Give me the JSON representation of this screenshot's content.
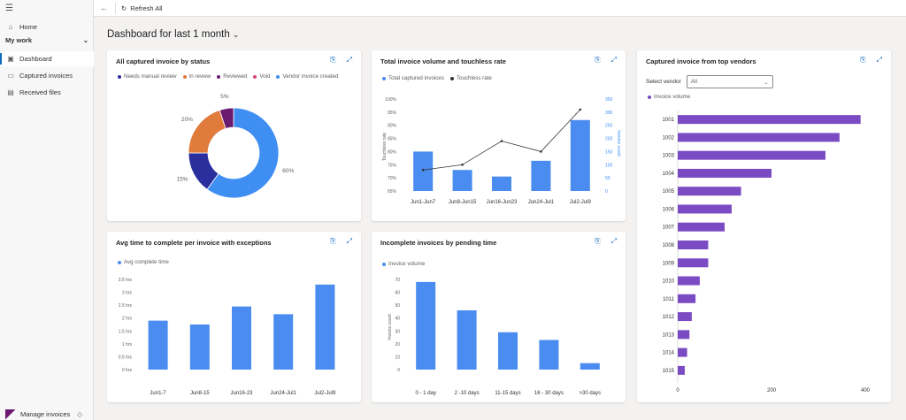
{
  "topbar": {
    "back_icon": "back-arrow-icon",
    "refresh_label": "Refresh All"
  },
  "sidebar": {
    "items": [
      {
        "label": "Home",
        "icon": "home-icon"
      },
      {
        "label": "Dashboard",
        "icon": "dashboard-icon",
        "active": true
      },
      {
        "label": "Captured invoices",
        "icon": "document-icon"
      },
      {
        "label": "Received files",
        "icon": "files-icon"
      }
    ],
    "section_label": "My work",
    "footer_label": "Manage invoices"
  },
  "page": {
    "title": "Dashboard for last 1 month"
  },
  "colors": {
    "accent": "#0f6cbd",
    "bar_blue": "#4a8cf0",
    "bar_purple": "#7b4bc4"
  },
  "cards": {
    "status": {
      "title": "All captured invoice by status",
      "chart_data": {
        "type": "pie",
        "labels": [
          "Needs manual review",
          "In review",
          "Reviewed",
          "Void",
          "Vendor invoice created"
        ],
        "values": [
          15,
          20,
          5,
          0,
          60
        ],
        "colors": [
          "#2b2f9e",
          "#e07b3c",
          "#6a1b6f",
          "#d6447f",
          "#3f8ef2"
        ],
        "slice_labels": [
          "15%",
          "20%",
          "5%",
          "",
          "60%"
        ]
      }
    },
    "volume": {
      "title": "Total invoice volume and touchless rate",
      "chart_data": {
        "type": "bar",
        "categories": [
          "Jun1-Jun7",
          "Jun8-Jun15",
          "Jun16-Jun23",
          "Jun24-Jul1",
          "Jul2-Jul9"
        ],
        "series": [
          {
            "name": "Total captured invoices",
            "values": [
              150,
              80,
              55,
              115,
              270
            ]
          },
          {
            "name": "Touchless rate",
            "values": [
              73,
              75,
              84,
              80,
              96
            ]
          }
        ],
        "ylabel": "Touchless rate",
        "y2label": "Invoice count",
        "yticks": [
          "65%",
          "70%",
          "75%",
          "80%",
          "85%",
          "90%",
          "95%",
          "100%"
        ],
        "y2ticks": [
          "0",
          "50",
          "100",
          "150",
          "200",
          "250",
          "300",
          "350"
        ],
        "ylim": [
          65,
          100
        ],
        "y2lim": [
          0,
          350
        ]
      }
    },
    "vendors": {
      "title": "Captured invoice from top vendors",
      "select_label": "Select vendor",
      "select_value": "All",
      "chart_data": {
        "type": "bar",
        "orientation": "horizontal",
        "categories": [
          "1001",
          "1002",
          "1003",
          "1004",
          "1005",
          "1006",
          "1007",
          "1008",
          "1009",
          "1010",
          "1011",
          "1012",
          "1013",
          "1014",
          "1015"
        ],
        "series": [
          {
            "name": "Invoice volume",
            "values": [
              390,
              345,
              315,
              200,
              135,
              115,
              100,
              65,
              65,
              47,
              38,
              30,
              25,
              20,
              15
            ]
          }
        ],
        "xticks": [
          "0",
          "200",
          "400"
        ],
        "xlim": [
          0,
          400
        ]
      }
    },
    "avgtime": {
      "title": "Avg time to complete per invoice with exceptions",
      "chart_data": {
        "type": "bar",
        "categories": [
          "Jun1-7",
          "Jun8-15",
          "Jun16-23",
          "Jun24-Jul1",
          "Jul2-Jul9"
        ],
        "series": [
          {
            "name": "Avg complete time",
            "values": [
              1.9,
              1.75,
              2.45,
              2.15,
              3.3
            ]
          }
        ],
        "yticks": [
          "0 hrs",
          "0.5 hrs",
          "1 hrs",
          "1.5 hrs",
          "2 hrs",
          "2.5 hrs",
          "3 hrs",
          "3.5 hrs"
        ],
        "ylim": [
          0,
          3.5
        ]
      }
    },
    "pending": {
      "title": "Incomplete invoices by pending time",
      "chart_data": {
        "type": "bar",
        "categories": [
          "0 - 1 day",
          "2 -10 days",
          "11-15 days",
          "16 - 30 days",
          ">30 days"
        ],
        "series": [
          {
            "name": "Invoice volume",
            "values": [
              68,
              46,
              29,
              23,
              5
            ]
          }
        ],
        "ylabel": "Invoice count",
        "yticks": [
          "0",
          "10",
          "20",
          "30",
          "40",
          "50",
          "60",
          "70"
        ],
        "ylim": [
          0,
          70
        ]
      }
    }
  }
}
